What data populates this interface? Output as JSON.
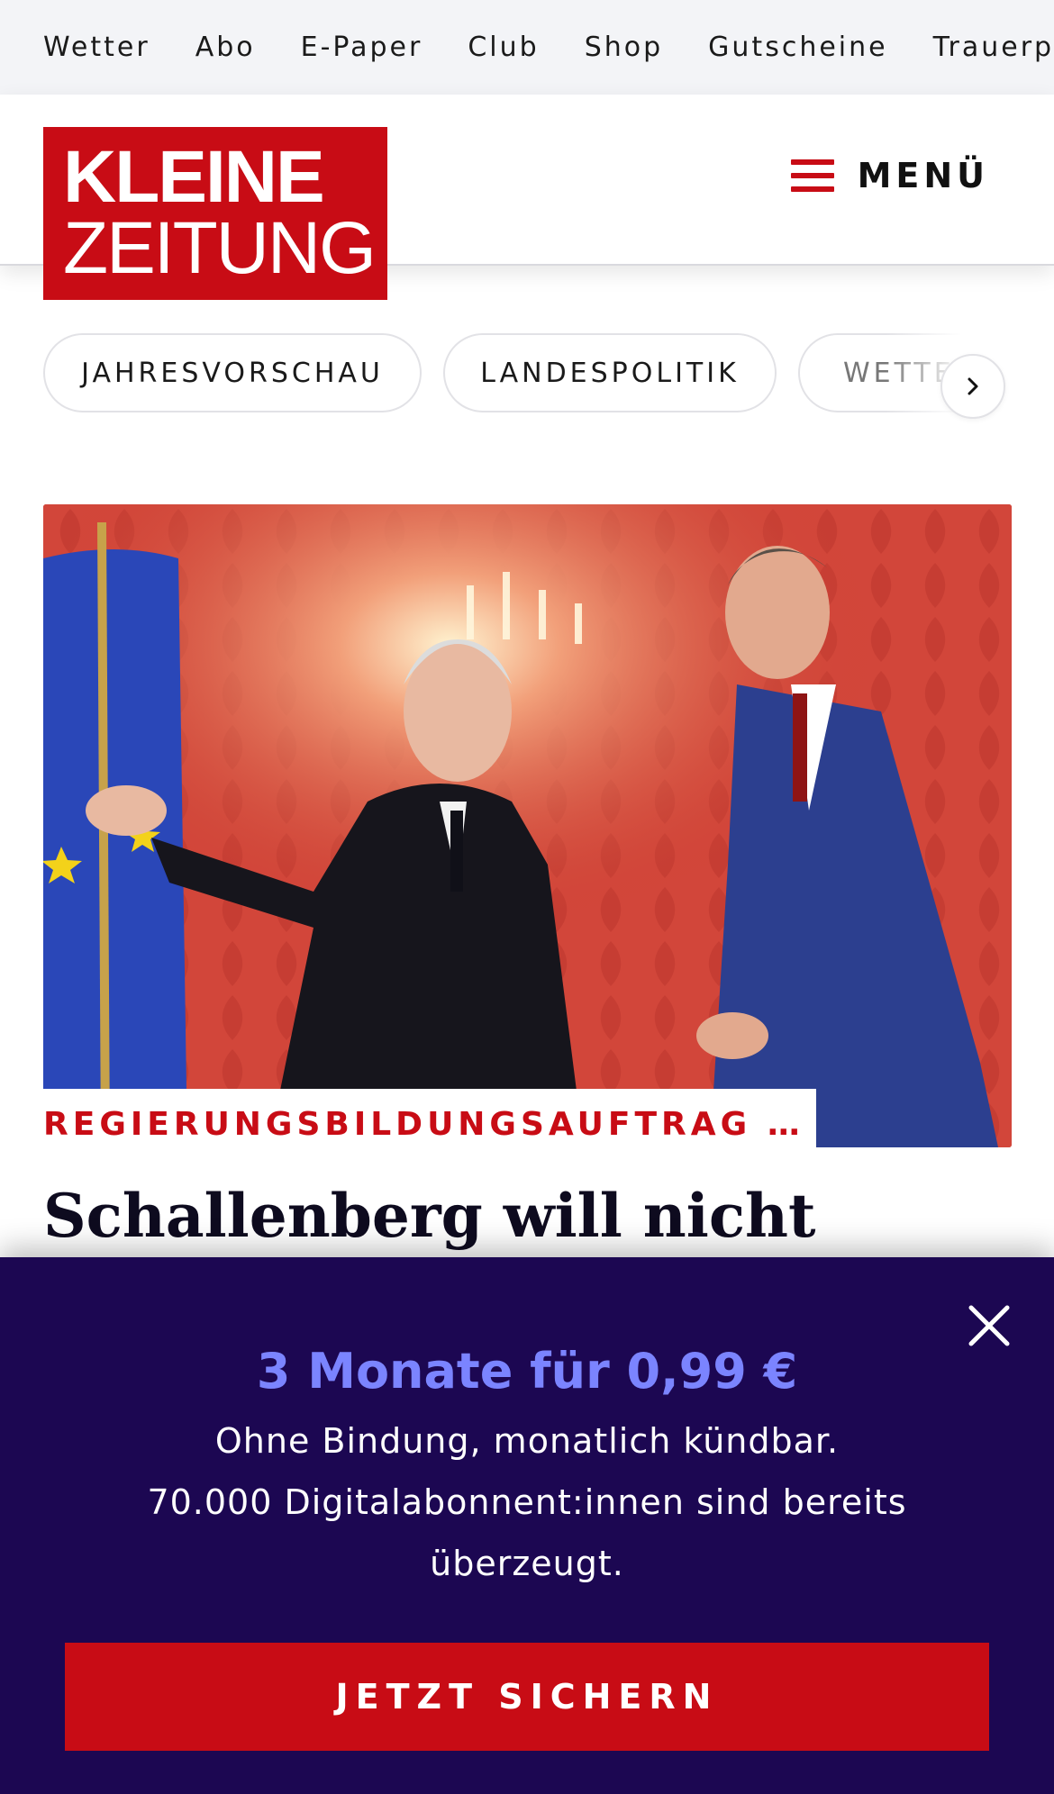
{
  "utility_nav": {
    "items": [
      "Wetter",
      "Abo",
      "E-Paper",
      "Club",
      "Shop",
      "Gutscheine",
      "Trauerportal"
    ]
  },
  "header": {
    "logo_line1": "KLEINE",
    "logo_line2": "ZEITUNG",
    "menu_label": "MENÜ",
    "brand_color": "#c80c15"
  },
  "topic_pills": {
    "items": [
      "JAHRESVORSCHAU",
      "LANDESPOLITIK",
      "WETTER"
    ],
    "next_icon": "chevron-right-icon"
  },
  "article": {
    "kicker": "REGIERUNGSBILDUNGSAUFTRAG FÜ…",
    "headline": "Schallenberg will nicht"
  },
  "subscription_overlay": {
    "offer_title": "3 Monate für 0,99 €",
    "line1": "Ohne Bindung, monatlich kündbar.",
    "line2": "70.000 Digitalabonnent:innen sind bereits",
    "line3": "überzeugt.",
    "cta_label": "JETZT SICHERN",
    "close_icon": "close-icon",
    "background_color": "#1c0752",
    "accent_color": "#7b84ff"
  }
}
